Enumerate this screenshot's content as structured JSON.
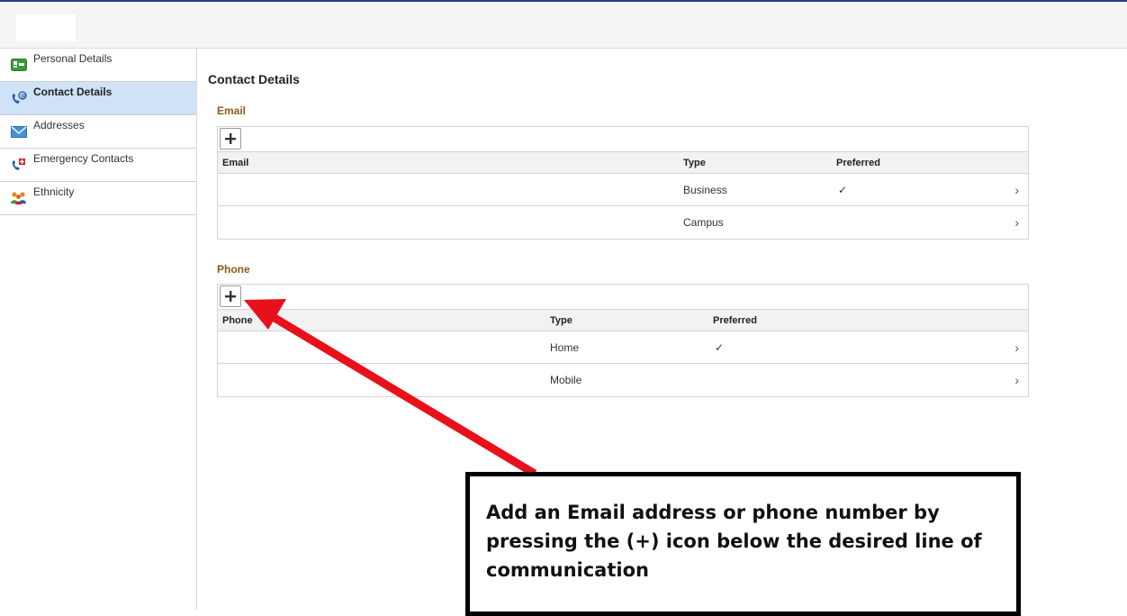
{
  "sidebar": {
    "items": [
      {
        "label": "Personal Details",
        "icon": "id-card-icon",
        "active": false
      },
      {
        "label": "Contact Details",
        "icon": "phone-contact-icon",
        "active": true
      },
      {
        "label": "Addresses",
        "icon": "envelope-icon",
        "active": false
      },
      {
        "label": "Emergency Contacts",
        "icon": "emergency-phone-icon",
        "active": false
      },
      {
        "label": "Ethnicity",
        "icon": "people-icon",
        "active": false
      }
    ]
  },
  "main": {
    "title": "Contact Details",
    "email": {
      "section_title": "Email",
      "columns": [
        "Email",
        "Type",
        "Preferred"
      ],
      "rows": [
        {
          "email": "",
          "type": "Business",
          "preferred": "✓"
        },
        {
          "email": "",
          "type": "Campus",
          "preferred": ""
        }
      ]
    },
    "phone": {
      "section_title": "Phone",
      "columns": [
        "Phone",
        "Type",
        "Preferred"
      ],
      "rows": [
        {
          "phone": "",
          "type": "Home",
          "preferred": "✓"
        },
        {
          "phone": "",
          "type": "Mobile",
          "preferred": ""
        }
      ]
    }
  },
  "annotation": {
    "text": "Add an Email address or phone number by pressing the (+) icon below the desired line of communication",
    "arrow_color": "#e8101a"
  },
  "colors": {
    "active_bg": "#cfe2f7",
    "section_title": "#8a5a14",
    "top_border": "#2d3a8c"
  }
}
